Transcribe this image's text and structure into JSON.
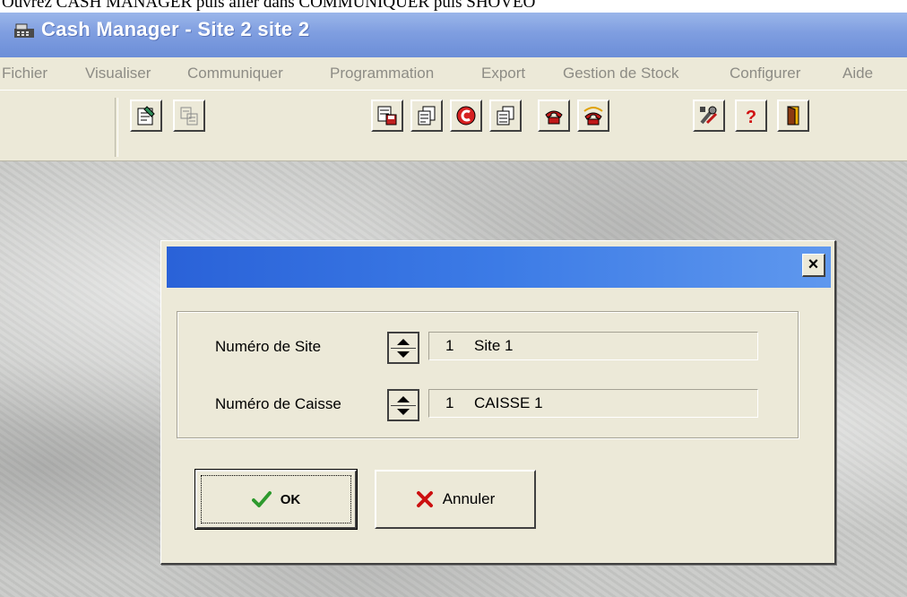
{
  "document_strip": {
    "text": "Ouvrez CASH MANAGER puis aller dans COMMUNIQUER puis SHOVEO"
  },
  "window": {
    "title": "Cash Manager - Site 2 site 2",
    "title_color": "#ffffff"
  },
  "menu": {
    "items": [
      "Fichier",
      "Visualiser",
      "Communiquer",
      "Programmation",
      "Export",
      "Gestion de Stock",
      "Configurer",
      "Aide"
    ]
  },
  "toolbar": {
    "buttons": [
      "edit-document-icon",
      "disabled-document-icon",
      "floppy-document-icon",
      "document-copy-icon",
      "c-refresh-icon",
      "documents-icon",
      "telephone-icon",
      "telephone-ring-icon",
      "tools-icon",
      "help-icon",
      "exit-door-icon"
    ]
  },
  "dialog": {
    "title": "",
    "close_label": "×",
    "site_label": "Numéro de Site",
    "site_number": "1",
    "site_name": "Site 1",
    "caisse_label": "Numéro de Caisse",
    "caisse_number": "1",
    "caisse_name": "CAISSE 1",
    "ok_label": "OK",
    "cancel_label": "Annuler"
  },
  "colors": {
    "caption_start": "#2a62d8",
    "caption_end": "#5f98ee",
    "face": "#ece9d8",
    "ok_check": "#2e9a2e",
    "cancel_cross": "#cc1010"
  }
}
